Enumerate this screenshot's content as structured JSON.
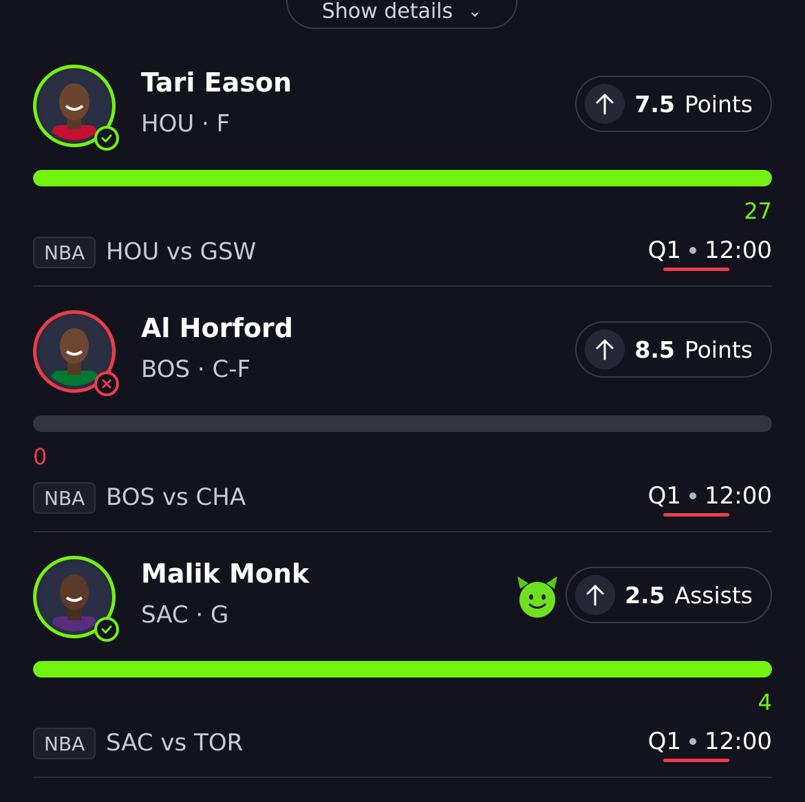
{
  "header": {
    "show_details_label": "Show details"
  },
  "colors": {
    "background": "#12131d",
    "accent_green": "#74f20f",
    "accent_red": "#ef3b4a",
    "track": "#34353f"
  },
  "picks": [
    {
      "name": "Tari Eason",
      "meta": "HOU · F",
      "status": "hit",
      "status_icon": "check-icon",
      "line": "7.5",
      "stat": "Points",
      "direction": "over",
      "progress": 1.0,
      "actual": "27",
      "league": "NBA",
      "matchup": "HOU vs GSW",
      "period": "Q1",
      "clock": "12:00",
      "emoji": null
    },
    {
      "name": "Al Horford",
      "meta": "BOS · C-F",
      "status": "miss",
      "status_icon": "x-icon",
      "line": "8.5",
      "stat": "Points",
      "direction": "over",
      "progress": 0.0,
      "actual": "0",
      "league": "NBA",
      "matchup": "BOS vs CHA",
      "period": "Q1",
      "clock": "12:00",
      "emoji": null
    },
    {
      "name": "Malik Monk",
      "meta": "SAC · G",
      "status": "hit",
      "status_icon": "check-icon",
      "line": "2.5",
      "stat": "Assists",
      "direction": "over",
      "progress": 1.0,
      "actual": "4",
      "league": "NBA",
      "matchup": "SAC vs TOR",
      "period": "Q1",
      "clock": "12:00",
      "emoji": "devil-emoji-icon"
    }
  ]
}
